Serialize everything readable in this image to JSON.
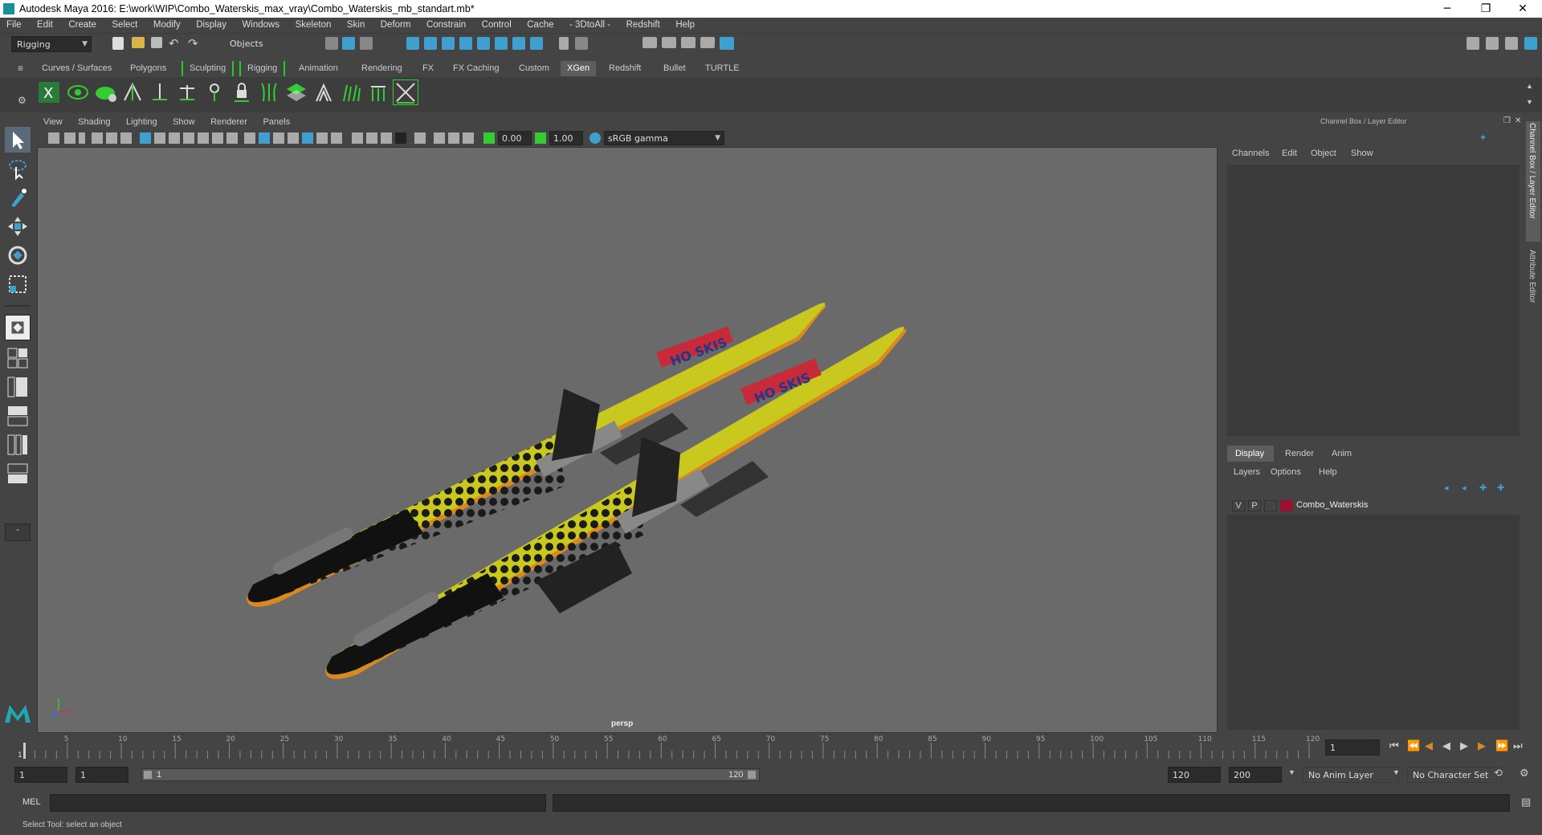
{
  "window": {
    "title": "Autodesk Maya 2016: E:\\work\\WIP\\Combo_Waterskis_max_vray\\Combo_Waterskis_mb_standart.mb*",
    "minimize": "─",
    "maximize": "❐",
    "close": "✕"
  },
  "menubar": [
    "File",
    "Edit",
    "Create",
    "Select",
    "Modify",
    "Display",
    "Windows",
    "Skeleton",
    "Skin",
    "Deform",
    "Constrain",
    "Control",
    "Cache",
    "- 3DtoAll -",
    "Redshift",
    "Help"
  ],
  "statusline": {
    "mode": "Rigging",
    "selection_mode": "Objects"
  },
  "shelf_tabs": [
    "Curves / Surfaces",
    "Polygons",
    "Sculpting",
    "Rigging",
    "Animation",
    "Rendering",
    "FX",
    "FX Caching",
    "Custom",
    "XGen",
    "Redshift",
    "Bullet",
    "TURTLE"
  ],
  "active_shelf": "XGen",
  "viewport": {
    "menu": [
      "View",
      "Shading",
      "Lighting",
      "Show",
      "Renderer",
      "Panels"
    ],
    "exposure": "0.00",
    "gamma": "1.00",
    "color_space": "sRGB gamma",
    "camera_label": "persp"
  },
  "channel_box": {
    "title": "Channel Box / Layer Editor",
    "menu": [
      "Channels",
      "Edit",
      "Object",
      "Show"
    ]
  },
  "layer_editor": {
    "tabs": [
      "Display",
      "Render",
      "Anim"
    ],
    "active_tab": "Display",
    "menu": [
      "Layers",
      "Options",
      "Help"
    ],
    "layers": [
      {
        "visible": "V",
        "playback": "P",
        "color": "#9a1030",
        "name": "Combo_Waterskis"
      }
    ]
  },
  "side_tabs": [
    "Channel Box / Layer Editor",
    "Attribute Editor"
  ],
  "timeline": {
    "ticks": [
      "5",
      "10",
      "15",
      "20",
      "25",
      "30",
      "35",
      "40",
      "45",
      "50",
      "55",
      "60",
      "65",
      "70",
      "75",
      "80",
      "85",
      "90",
      "95",
      "100",
      "105",
      "110",
      "115",
      "120"
    ],
    "start_tick": "1",
    "current_frame": "1"
  },
  "range": {
    "start": "1",
    "start_inner": "1",
    "slider_start": "1",
    "slider_end": "120",
    "end_inner": "120",
    "end": "200",
    "anim_layer": "No Anim Layer",
    "character_set": "No Character Set"
  },
  "mel": {
    "label": "MEL"
  },
  "help_line": "Select Tool: select an object",
  "colors": {
    "ski_yellow": "#c8c81e",
    "ski_orange": "#d98a1f",
    "layer_color": "#9a1030",
    "active_icon": "#3fa0d0"
  }
}
